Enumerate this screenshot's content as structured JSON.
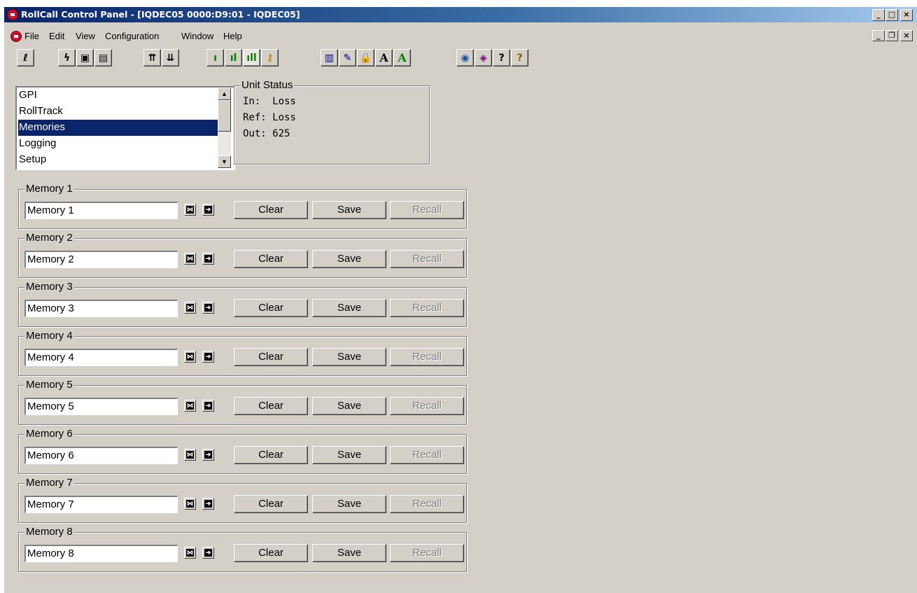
{
  "window": {
    "title": "RollCall Control Panel - [IQDEC05 0000:D9:01 - IQDEC05]"
  },
  "caption_buttons": {
    "minimize": "_",
    "maximize": "□",
    "close": "×"
  },
  "mdi_buttons": {
    "minimize": "_",
    "restore": "❐",
    "close": "×"
  },
  "menu": [
    "File",
    "Edit",
    "View",
    "Configuration",
    "Window",
    "Help"
  ],
  "toolbar": {
    "buttons": [
      {
        "icon": "network-tree-icon",
        "glyph": "ℓ"
      },
      {
        "icon": "lightning-icon",
        "glyph": "ϟ"
      },
      {
        "icon": "save-icon",
        "glyph": "▣"
      },
      {
        "icon": "save-as-icon",
        "glyph": "▤"
      },
      {
        "icon": "upload-icon",
        "glyph": "⇈"
      },
      {
        "icon": "download-icon",
        "glyph": "⇊"
      },
      {
        "icon": "level-low-icon",
        "glyph": "ı"
      },
      {
        "icon": "level-mid-icon",
        "glyph": "ıl"
      },
      {
        "icon": "level-high-icon",
        "glyph": "ıll"
      },
      {
        "icon": "key-icon",
        "glyph": "⚷"
      },
      {
        "icon": "book-icon",
        "glyph": "▥"
      },
      {
        "icon": "edit-form-icon",
        "glyph": "✎"
      },
      {
        "icon": "lock-icon",
        "glyph": "🔒"
      },
      {
        "icon": "font-icon",
        "glyph": "A"
      },
      {
        "icon": "font-color-icon",
        "glyph": "A"
      },
      {
        "icon": "globe-icon",
        "glyph": "◉"
      },
      {
        "icon": "eraser-icon",
        "glyph": "◈"
      },
      {
        "icon": "help-dialog-icon",
        "glyph": "?"
      },
      {
        "icon": "help-icon",
        "glyph": "?"
      }
    ]
  },
  "nav_list": {
    "items": [
      "GPI",
      "RollTrack",
      "Memories",
      "Logging",
      "Setup"
    ],
    "selected": "Memories"
  },
  "unit_status": {
    "label": "Unit Status",
    "lines": [
      "In:  Loss",
      "Ref: Loss",
      "Out: 625"
    ]
  },
  "memories": [
    {
      "label": "Memory 1",
      "value": "Memory 1"
    },
    {
      "label": "Memory 2",
      "value": "Memory 2"
    },
    {
      "label": "Memory 3",
      "value": "Memory 3"
    },
    {
      "label": "Memory 4",
      "value": "Memory 4"
    },
    {
      "label": "Memory 5",
      "value": "Memory 5"
    },
    {
      "label": "Memory 6",
      "value": "Memory 6"
    },
    {
      "label": "Memory 7",
      "value": "Memory 7"
    },
    {
      "label": "Memory 8",
      "value": "Memory 8"
    }
  ],
  "memory_buttons": {
    "clear": "Clear",
    "save": "Save",
    "recall": "Recall"
  },
  "colors": {
    "selection": "#0a246a",
    "face": "#d4d0c8",
    "title_start": "#0a246a",
    "title_end": "#a6caf0"
  }
}
